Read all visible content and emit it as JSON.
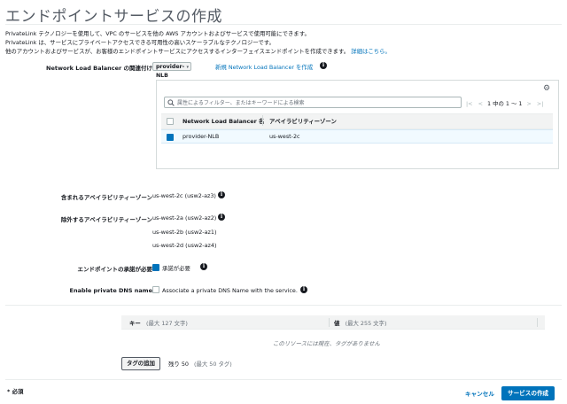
{
  "header": {
    "title": "エンドポイントサービスの作成"
  },
  "description": {
    "line1": "PrivateLink テクノロジーを使用して、VPC のサービスを他の AWS アカウントおよびサービスで使用可能にできます。",
    "line2": "PrivateLink は、サービスにプライベートアクセスできる可用性の高いスケーラブルなテクノロジーです。",
    "line3": "他のアカウントおよびサービスが、お客様のエンドポイントサービスにアクセスするインターフェイスエンドポイントを作成できます。",
    "learn_more": "詳細はこちら。"
  },
  "nlb": {
    "label": "Network Load Balancer の関連付け",
    "selected": "provider-NLB",
    "create_link": "新規 Network Load Balancer を作成",
    "search_placeholder": "属性によるフィルター、またはキーワードによる検索",
    "pagination": "1 中の 1 ～ 1",
    "columns": [
      "Network Load Balancer 名",
      "アベイラビリティーゾーン"
    ],
    "rows": [
      {
        "name": "provider-NLB",
        "zone": "us-west-2c",
        "selected": true
      }
    ]
  },
  "included_az": {
    "label": "含まれるアベイラビリティーゾーン",
    "values": [
      "us-west-2c (usw2-az3)"
    ]
  },
  "excluded_az": {
    "label": "除外するアベイラビリティーゾーン",
    "values": [
      "us-west-2a (usw2-az2)",
      "us-west-2b (usw2-az1)",
      "us-west-2d (usw2-az4)"
    ]
  },
  "acceptance": {
    "label": "エンドポイントの承諾が必要",
    "checkbox_label": "承諾が必要",
    "checked": true
  },
  "private_dns": {
    "label": "Enable private DNS name",
    "checkbox_label": "Associate a private DNS Name with the service.",
    "checked": false
  },
  "tags": {
    "key_header": "キー",
    "key_hint": "(最大 127 文字)",
    "value_header": "値",
    "value_hint": "(最大 255 文字)",
    "empty_message": "このリソースには現在、タグがありません",
    "add_button": "タグの追加",
    "remaining": "残り 50",
    "max_hint": "(最大 50 タグ)"
  },
  "footer": {
    "required_note": "* 必須",
    "cancel": "キャンセル",
    "create": "サービスの作成"
  },
  "colors": {
    "primary": "#0073bb",
    "header_bg": "#f2f3f3",
    "selected_row": "#f1faff",
    "text": "#16191f"
  },
  "icons": {
    "info": "info-icon",
    "gear": "gear-icon",
    "search": "search-icon",
    "first": "first-page-icon",
    "prev": "prev-page-icon",
    "next": "next-page-icon",
    "last": "last-page-icon",
    "dropdown": "caret-down-icon"
  }
}
